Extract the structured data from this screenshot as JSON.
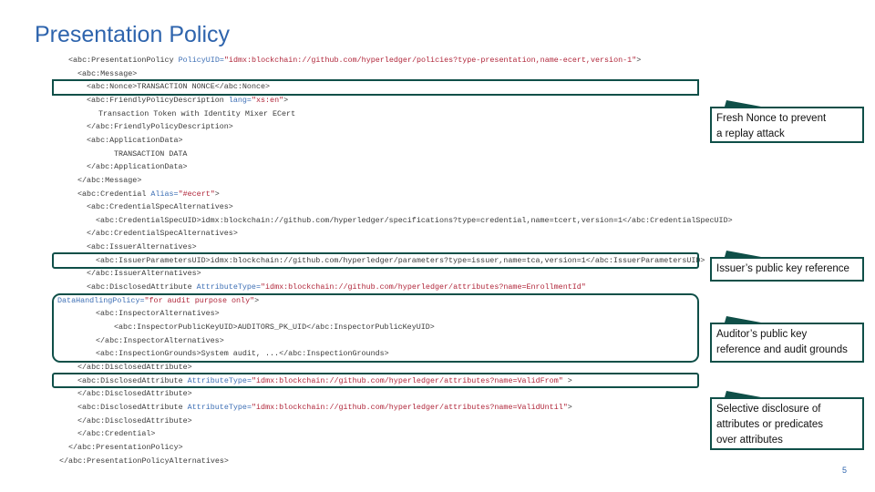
{
  "slide": {
    "title": "Presentation Policy",
    "page_number": "5"
  },
  "code_lines": [
    {
      "indent": 75,
      "parts": [
        [
          "tag",
          "<abc:PresentationPolicy "
        ],
        [
          "attr",
          "PolicyUID="
        ],
        [
          "val",
          "\"idmx:blockchain://github.com/hyperledger/policies?type-presentation,name-ecert,version-1\""
        ],
        [
          "tag",
          ">"
        ]
      ]
    },
    {
      "indent": 85,
      "parts": [
        [
          "tag",
          "<abc:Message>"
        ]
      ]
    },
    {
      "indent": 95,
      "parts": [
        [
          "tag",
          "<abc:Nonce>"
        ],
        [
          "text",
          "TRANSACTION NONCE"
        ],
        [
          "tag",
          "</abc:Nonce>"
        ]
      ]
    },
    {
      "indent": 95,
      "parts": [
        [
          "tag",
          "<abc:FriendlyPolicyDescription "
        ],
        [
          "attr",
          "lang="
        ],
        [
          "val",
          "\"xs:en\""
        ],
        [
          "tag",
          ">"
        ]
      ]
    },
    {
      "indent": 108,
      "parts": [
        [
          "text",
          "Transaction Token with Identity Mixer ECert"
        ]
      ]
    },
    {
      "indent": 95,
      "parts": [
        [
          "tag",
          "</abc:FriendlyPolicyDescription>"
        ]
      ]
    },
    {
      "indent": 95,
      "parts": [
        [
          "tag",
          "<abc:ApplicationData>"
        ]
      ]
    },
    {
      "indent": 125,
      "parts": [
        [
          "text",
          "TRANSACTION DATA"
        ]
      ]
    },
    {
      "indent": 95,
      "parts": [
        [
          "tag",
          "</abc:ApplicationData>"
        ]
      ]
    },
    {
      "indent": 85,
      "parts": [
        [
          "tag",
          "</abc:Message>"
        ]
      ]
    },
    {
      "indent": 85,
      "parts": [
        [
          "tag",
          "<abc:Credential "
        ],
        [
          "attr",
          "Alias="
        ],
        [
          "val",
          "\"#ecert\""
        ],
        [
          "tag",
          ">"
        ]
      ]
    },
    {
      "indent": 95,
      "parts": [
        [
          "tag",
          "<abc:CredentialSpecAlternatives>"
        ]
      ]
    },
    {
      "indent": 105,
      "parts": [
        [
          "tag",
          "<abc:CredentialSpecUID>"
        ],
        [
          "text",
          "idmx:blockchain://github.com/hyperledger/specifications?type=credential,name=tcert,version=1"
        ],
        [
          "tag",
          "</abc:CredentialSpecUID>"
        ]
      ]
    },
    {
      "indent": 95,
      "parts": [
        [
          "tag",
          "</abc:CredentialSpecAlternatives>"
        ]
      ]
    },
    {
      "indent": 95,
      "parts": [
        [
          "tag",
          "<abc:IssuerAlternatives>"
        ]
      ]
    },
    {
      "indent": 105,
      "parts": [
        [
          "tag",
          "<abc:IssuerParametersUID>"
        ],
        [
          "text",
          "idmx:blockchain://github.com/hyperledger/parameters?type=issuer,name=tca,version=1"
        ],
        [
          "tag",
          "</abc:IssuerParametersUID>"
        ]
      ]
    },
    {
      "indent": 95,
      "parts": [
        [
          "tag",
          "</abc:IssuerAlternatives>"
        ]
      ]
    },
    {
      "indent": 95,
      "parts": [
        [
          "tag",
          "<abc:DisclosedAttribute "
        ],
        [
          "attr",
          "AttributeType="
        ],
        [
          "val",
          "\"idmx:blockchain://github.com/hyperledger/attributes?name=EnrollmentId\""
        ]
      ]
    },
    {
      "indent": 63,
      "parts": [
        [
          "attr",
          "DataHandlingPolicy="
        ],
        [
          "val",
          "\"for audit purpose only\""
        ],
        [
          "tag",
          ">"
        ]
      ]
    },
    {
      "indent": 105,
      "parts": [
        [
          "tag",
          "<abc:InspectorAlternatives>"
        ]
      ]
    },
    {
      "indent": 125,
      "parts": [
        [
          "tag",
          "<abc:InspectorPublicKeyUID>"
        ],
        [
          "text",
          "AUDITORS_PK_UID"
        ],
        [
          "tag",
          "</abc:InspectorPublicKeyUID>"
        ]
      ]
    },
    {
      "indent": 105,
      "parts": [
        [
          "tag",
          "</abc:InspectorAlternatives>"
        ]
      ]
    },
    {
      "indent": 105,
      "parts": [
        [
          "tag",
          "<abc:InspectionGrounds>"
        ],
        [
          "text",
          "System audit, ..."
        ],
        [
          "tag",
          "</abc:InspectionGrounds>"
        ]
      ]
    },
    {
      "indent": 85,
      "parts": [
        [
          "tag",
          "</abc:DisclosedAttribute>"
        ]
      ]
    },
    {
      "indent": 85,
      "parts": [
        [
          "tag",
          "<abc:DisclosedAttribute "
        ],
        [
          "attr",
          "AttributeType="
        ],
        [
          "val",
          "\"idmx:blockchain://github.com/hyperledger/attributes?name=ValidFrom\""
        ],
        [
          "tag",
          " >"
        ]
      ]
    },
    {
      "indent": 85,
      "parts": [
        [
          "tag",
          "</abc:DisclosedAttribute>"
        ]
      ]
    },
    {
      "indent": 85,
      "parts": [
        [
          "tag",
          "<abc:DisclosedAttribute "
        ],
        [
          "attr",
          "AttributeType="
        ],
        [
          "val",
          "\"idmx:blockchain://github.com/hyperledger/attributes?name=ValidUntil\""
        ],
        [
          "tag",
          ">"
        ]
      ]
    },
    {
      "indent": 85,
      "parts": [
        [
          "tag",
          "</abc:DisclosedAttribute>"
        ]
      ]
    },
    {
      "indent": 85,
      "parts": [
        [
          "tag",
          "</abc:Credential>"
        ]
      ]
    },
    {
      "indent": 75,
      "parts": [
        [
          "tag",
          "</abc:PresentationPolicy>"
        ]
      ]
    },
    {
      "indent": 65,
      "parts": [
        [
          "tag",
          "</abc:PresentationPolicyAlternatives>"
        ]
      ]
    }
  ],
  "callouts": {
    "nonce": {
      "line1": "Fresh Nonce to prevent",
      "line2": "a replay attack"
    },
    "issuer": {
      "line1": "Issuer’s public key reference"
    },
    "auditor": {
      "line1": "Auditor’s public key",
      "line2": "reference and audit grounds"
    },
    "disclosure": {
      "line1": "Selective disclosure of",
      "line2": "attributes or predicates",
      "line3": "over attributes"
    }
  },
  "colors": {
    "accent": "#0f4f48",
    "title": "#2e64ad",
    "value": "#b0263a",
    "attr": "#3d6fb5"
  }
}
